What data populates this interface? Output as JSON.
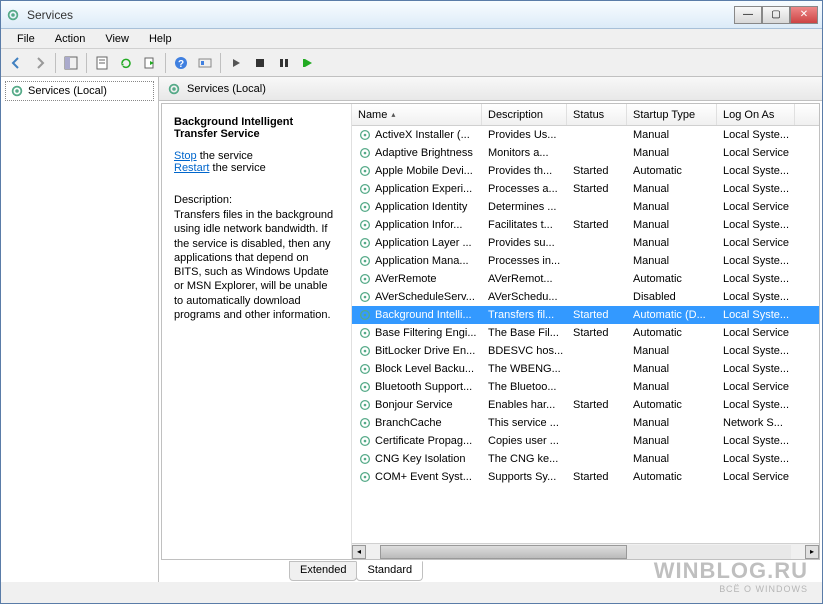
{
  "window": {
    "title": "Services"
  },
  "menubar": [
    "File",
    "Action",
    "View",
    "Help"
  ],
  "tree": {
    "root": "Services (Local)"
  },
  "detail_header": "Services (Local)",
  "info": {
    "title": "Background Intelligent Transfer Service",
    "stop": "Stop",
    "restart": "Restart",
    "the_service": " the service",
    "desc_label": "Description:",
    "desc": "Transfers files in the background using idle network bandwidth. If the service is disabled, then any applications that depend on BITS, such as Windows Update or MSN Explorer, will be unable to automatically download programs and other information."
  },
  "columns": {
    "name": "Name",
    "desc": "Description",
    "status": "Status",
    "startup": "Startup Type",
    "logon": "Log On As"
  },
  "services": [
    {
      "name": "ActiveX Installer (...",
      "desc": "Provides Us...",
      "status": "",
      "startup": "Manual",
      "logon": "Local Syste..."
    },
    {
      "name": "Adaptive Brightness",
      "desc": "Monitors a...",
      "status": "",
      "startup": "Manual",
      "logon": "Local Service"
    },
    {
      "name": "Apple Mobile Devi...",
      "desc": "Provides th...",
      "status": "Started",
      "startup": "Automatic",
      "logon": "Local Syste..."
    },
    {
      "name": "Application Experi...",
      "desc": "Processes a...",
      "status": "Started",
      "startup": "Manual",
      "logon": "Local Syste..."
    },
    {
      "name": "Application Identity",
      "desc": "Determines ...",
      "status": "",
      "startup": "Manual",
      "logon": "Local Service"
    },
    {
      "name": "Application Infor...",
      "desc": "Facilitates t...",
      "status": "Started",
      "startup": "Manual",
      "logon": "Local Syste..."
    },
    {
      "name": "Application Layer ...",
      "desc": "Provides su...",
      "status": "",
      "startup": "Manual",
      "logon": "Local Service"
    },
    {
      "name": "Application Mana...",
      "desc": "Processes in...",
      "status": "",
      "startup": "Manual",
      "logon": "Local Syste..."
    },
    {
      "name": "AVerRemote",
      "desc": "AVerRemot...",
      "status": "",
      "startup": "Automatic",
      "logon": "Local Syste..."
    },
    {
      "name": "AVerScheduleServ...",
      "desc": "AVerSchedu...",
      "status": "",
      "startup": "Disabled",
      "logon": "Local Syste..."
    },
    {
      "name": "Background Intelli...",
      "desc": "Transfers fil...",
      "status": "Started",
      "startup": "Automatic (D...",
      "logon": "Local Syste...",
      "selected": true
    },
    {
      "name": "Base Filtering Engi...",
      "desc": "The Base Fil...",
      "status": "Started",
      "startup": "Automatic",
      "logon": "Local Service"
    },
    {
      "name": "BitLocker Drive En...",
      "desc": "BDESVC hos...",
      "status": "",
      "startup": "Manual",
      "logon": "Local Syste..."
    },
    {
      "name": "Block Level Backu...",
      "desc": "The WBENG...",
      "status": "",
      "startup": "Manual",
      "logon": "Local Syste..."
    },
    {
      "name": "Bluetooth Support...",
      "desc": "The Bluetoo...",
      "status": "",
      "startup": "Manual",
      "logon": "Local Service"
    },
    {
      "name": "Bonjour Service",
      "desc": "Enables har...",
      "status": "Started",
      "startup": "Automatic",
      "logon": "Local Syste..."
    },
    {
      "name": "BranchCache",
      "desc": "This service ...",
      "status": "",
      "startup": "Manual",
      "logon": "Network S..."
    },
    {
      "name": "Certificate Propag...",
      "desc": "Copies user ...",
      "status": "",
      "startup": "Manual",
      "logon": "Local Syste..."
    },
    {
      "name": "CNG Key Isolation",
      "desc": "The CNG ke...",
      "status": "",
      "startup": "Manual",
      "logon": "Local Syste..."
    },
    {
      "name": "COM+ Event Syst...",
      "desc": "Supports Sy...",
      "status": "Started",
      "startup": "Automatic",
      "logon": "Local Service"
    }
  ],
  "tabs": {
    "extended": "Extended",
    "standard": "Standard"
  },
  "watermark": {
    "big": "WINBLOG.RU",
    "small": "ВСЁ О WINDOWS"
  }
}
